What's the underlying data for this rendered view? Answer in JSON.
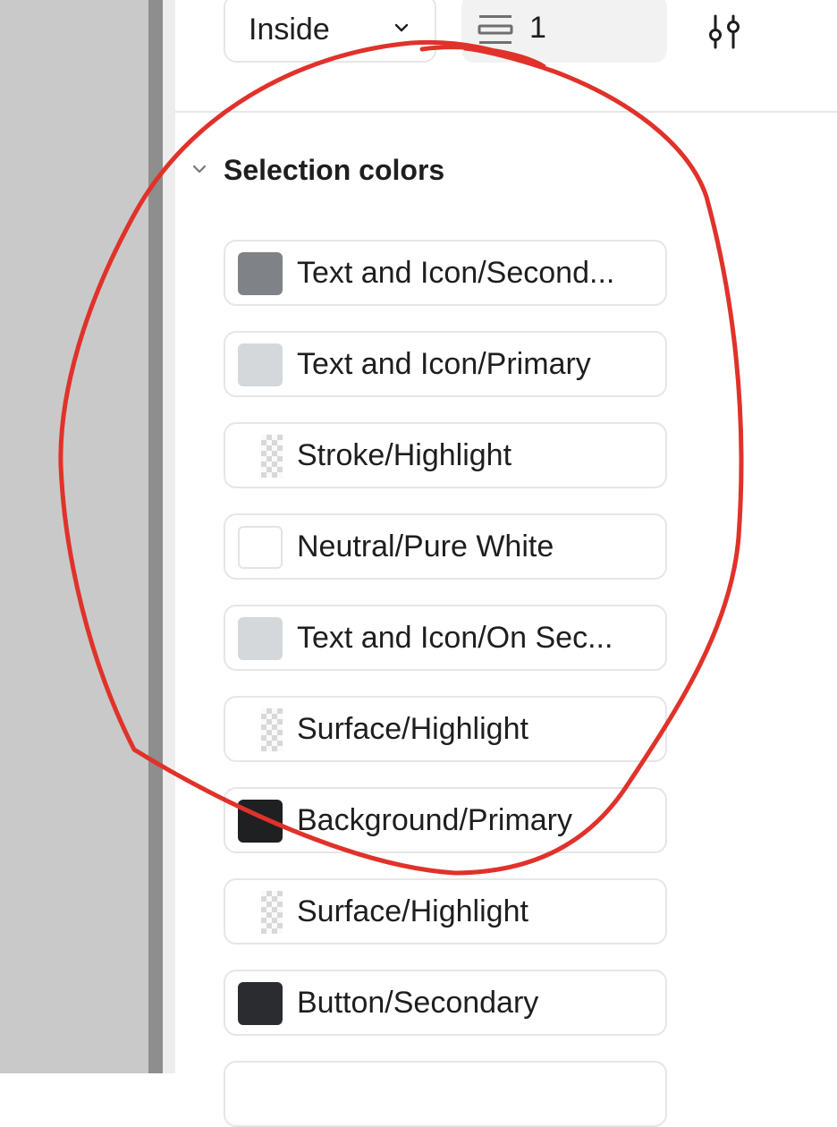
{
  "stroke": {
    "position_label": "Inside",
    "weight_value": "1"
  },
  "selection_colors": {
    "title": "Selection colors",
    "items": [
      {
        "name": "Text and Icon/Second...",
        "color": "#7f8286",
        "swatch": "solid"
      },
      {
        "name": "Text and Icon/Primary",
        "color": "#d5d8da",
        "swatch": "solid"
      },
      {
        "name": "Stroke/Highlight",
        "color": "transparent",
        "swatch": "checker"
      },
      {
        "name": "Neutral/Pure White",
        "color": "#ffffff",
        "swatch": "bordered"
      },
      {
        "name": "Text and Icon/On Sec...",
        "color": "#d5d8da",
        "swatch": "solid"
      },
      {
        "name": "Surface/Highlight",
        "color": "transparent",
        "swatch": "checker"
      },
      {
        "name": "Background/Primary",
        "color": "#1f2022",
        "swatch": "solid"
      },
      {
        "name": "Surface/Highlight",
        "color": "transparent",
        "swatch": "checker"
      },
      {
        "name": "Button/Secondary",
        "color": "#2b2c30",
        "swatch": "solid"
      }
    ]
  },
  "colors": {
    "canvas": "#c9c9c9",
    "annotation_stroke": "#e0322a"
  }
}
